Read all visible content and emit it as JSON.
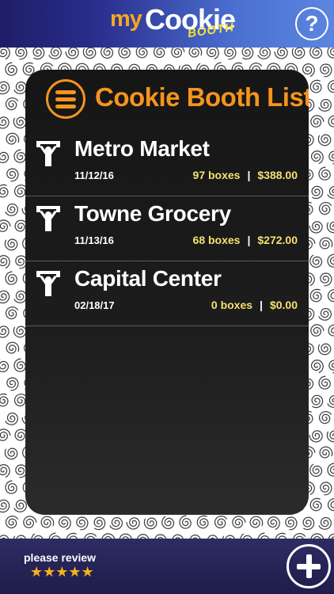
{
  "header": {
    "logo_my": "my",
    "logo_cookie": "Cookie",
    "logo_booth": "BOOTH",
    "help_label": "?"
  },
  "panel": {
    "title": "Cookie Booth List",
    "menu_icon": "hamburger-menu-icon"
  },
  "booths": [
    {
      "name": "Metro Market",
      "date": "11/12/16",
      "boxes": "97 boxes",
      "amount": "$388.00",
      "icon": "booth-person-icon"
    },
    {
      "name": "Towne Grocery",
      "date": "11/13/16",
      "boxes": "68 boxes",
      "amount": "$272.00",
      "icon": "booth-person-icon"
    },
    {
      "name": "Capital Center",
      "date": "02/18/17",
      "boxes": "0 boxes",
      "amount": "$0.00",
      "icon": "booth-person-icon"
    }
  ],
  "separator": "|",
  "footer": {
    "review_label": "please review",
    "stars": "★★★★★",
    "add_icon": "plus-icon"
  },
  "colors": {
    "accent_orange": "#f7941d",
    "stat_yellow": "#f5e170",
    "header_blue": "#2a2f8e",
    "footer_navy": "#1f1d4a"
  }
}
